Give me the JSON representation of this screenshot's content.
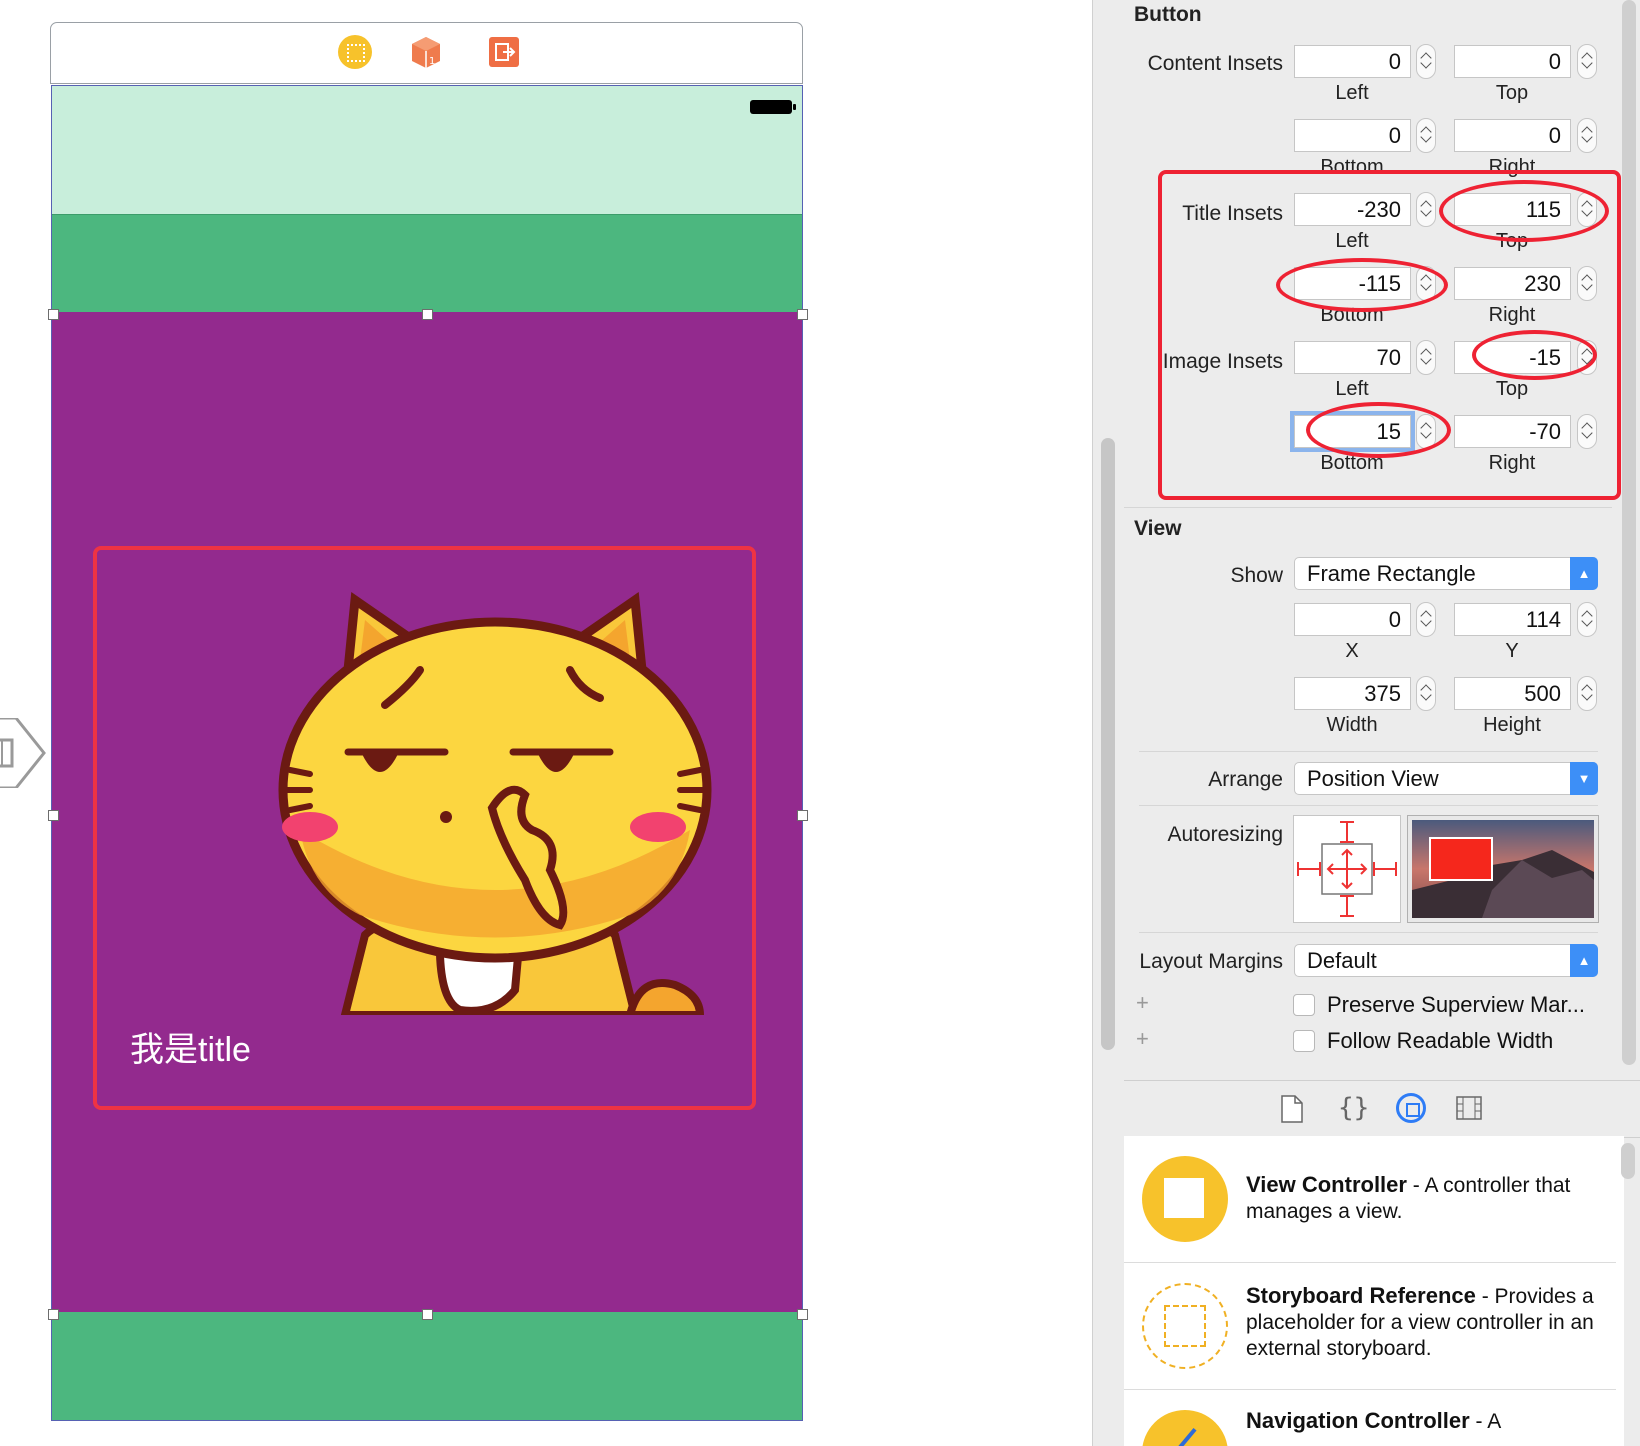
{
  "canvas": {
    "button_title": "我是title",
    "scene_dock_icons": [
      "view-controller-icon",
      "first-responder-icon",
      "exit-icon"
    ]
  },
  "inspector": {
    "button_section": {
      "title": "Button",
      "content_insets": {
        "label": "Content Insets",
        "left": "0",
        "top": "0",
        "bottom": "0",
        "right": "0"
      },
      "title_insets": {
        "label": "Title Insets",
        "left": "-230",
        "top": "115",
        "bottom": "-115",
        "right": "230"
      },
      "image_insets": {
        "label": "Image Insets",
        "left": "70",
        "top": "-15",
        "bottom": "15",
        "right": "-70"
      },
      "captions": {
        "left": "Left",
        "top": "Top",
        "bottom": "Bottom",
        "right": "Right"
      }
    },
    "view_section": {
      "title": "View",
      "show_label": "Show",
      "show_value": "Frame Rectangle",
      "x": "0",
      "y": "114",
      "width": "375",
      "height": "500",
      "x_cap": "X",
      "y_cap": "Y",
      "width_cap": "Width",
      "height_cap": "Height",
      "arrange_label": "Arrange",
      "arrange_value": "Position View",
      "autoresizing_label": "Autoresizing",
      "layout_margins_label": "Layout Margins",
      "layout_margins_value": "Default",
      "preserve_label": "Preserve Superview Mar...",
      "follow_label": "Follow Readable Width"
    },
    "library": [
      {
        "name": "View Controller",
        "desc": " - A controller that manages a view."
      },
      {
        "name": "Storyboard Reference",
        "desc": " - Provides a placeholder for a view controller in an external storyboard."
      },
      {
        "name": "Navigation Controller",
        "desc": " - A"
      }
    ]
  },
  "colors": {
    "status_area": "#c8eedb",
    "green": "#4cb77f",
    "purple": "#932a8e",
    "annotation_red": "#ee2233",
    "accent_blue": "#3d8ff7"
  }
}
